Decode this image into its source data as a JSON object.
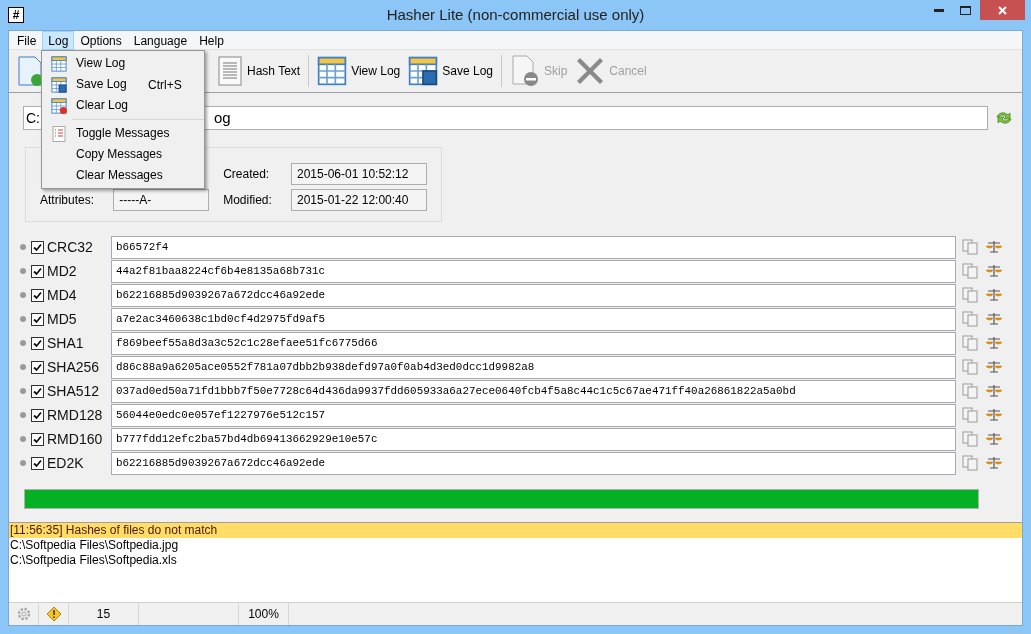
{
  "window": {
    "title": "Hasher Lite (non-commercial use only)",
    "icon": "#"
  },
  "menubar": [
    {
      "label": "File",
      "selected": false
    },
    {
      "label": "Log",
      "selected": true
    },
    {
      "label": "Options",
      "selected": false
    },
    {
      "label": "Language",
      "selected": false
    },
    {
      "label": "Help",
      "selected": false
    }
  ],
  "toolbar": [
    {
      "label": "Hash Text",
      "kind": "text",
      "disabled": false
    },
    {
      "label": "View Log",
      "kind": "grid",
      "disabled": false
    },
    {
      "label": "Save Log",
      "kind": "save",
      "disabled": false
    },
    {
      "label": "Skip",
      "kind": "skip",
      "disabled": true
    },
    {
      "label": "Cancel",
      "kind": "cancel",
      "disabled": true
    }
  ],
  "path_field": {
    "visible_start": "C:",
    "visible_end": "og"
  },
  "file_info": [
    {
      "label": "Attributes:",
      "value": "-----A-"
    },
    {
      "label": "Created:",
      "value": "2015-06-01 10:52:12"
    },
    {
      "label": "Modified:",
      "value": "2015-01-22 12:00:40"
    }
  ],
  "hashes": [
    {
      "name": "CRC32",
      "checked": true,
      "value": "b66572f4"
    },
    {
      "name": "MD2",
      "checked": true,
      "value": "44a2f81baa8224cf6b4e8135a68b731c"
    },
    {
      "name": "MD4",
      "checked": true,
      "value": "b62216885d9039267a672dcc46a92ede"
    },
    {
      "name": "MD5",
      "checked": true,
      "value": "a7e2ac3460638c1bd0cf4d2975fd9af5"
    },
    {
      "name": "SHA1",
      "checked": true,
      "value": "f869beef55a8d3a3c52c1c28efaee51fc6775d66"
    },
    {
      "name": "SHA256",
      "checked": true,
      "value": "d86c88a9a6205ace0552f781a07dbb2b938defd97a0f0ab4d3ed0dcc1d9982a8"
    },
    {
      "name": "SHA512",
      "checked": true,
      "value": "037ad0ed50a71fd1bbb7f50e7728c64d436da9937fdd605933a6a27ece0640fcb4f5a8c44c1c5c67ae471ff40a26861822a5a0bd"
    },
    {
      "name": "RMD128",
      "checked": true,
      "value": "56044e0edc0e057ef1227976e512c157"
    },
    {
      "name": "RMD160",
      "checked": true,
      "value": "b777fdd12efc2ba57bd4db69413662929e10e57c"
    },
    {
      "name": "ED2K",
      "checked": true,
      "value": "b62216885d9039267a672dcc46a92ede"
    }
  ],
  "progress": {
    "level": 1
  },
  "log": [
    {
      "text": "[11:56:35] Hashes of files do not match",
      "selected": true
    },
    {
      "text": "C:\\Softpedia Files\\Softpedia.jpg",
      "selected": false
    },
    {
      "text": "C:\\Softpedia Files\\Softpedia.xls",
      "selected": false
    }
  ],
  "status_bar": {
    "count": "15",
    "zoom": "100%"
  },
  "log_menu": [
    {
      "label": "View Log"
    },
    {
      "label": "Save Log",
      "shortcut": "Ctrl+S"
    },
    {
      "label": "Clear Log"
    },
    {
      "label": "Toggle Messages"
    },
    {
      "label": "Copy Messages"
    },
    {
      "label": "Clear Messages"
    }
  ]
}
